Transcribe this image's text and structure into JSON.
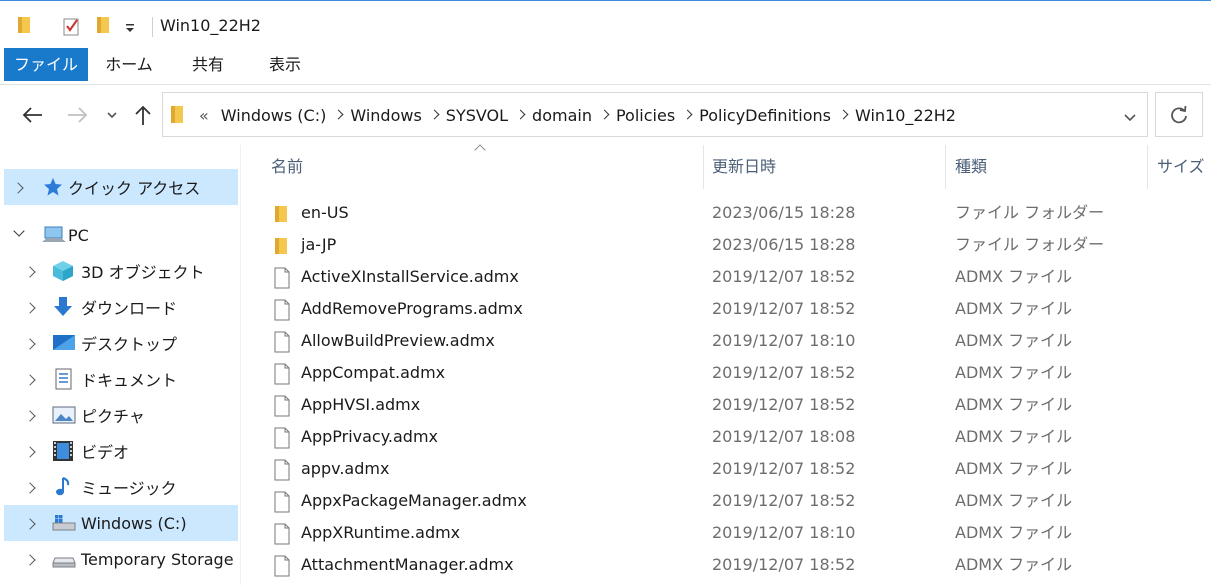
{
  "window": {
    "title": "Win10_22H2"
  },
  "ribbon": {
    "tabs": [
      "ファイル",
      "ホーム",
      "共有",
      "表示"
    ]
  },
  "address": {
    "overflow": "«",
    "crumbs": [
      "Windows (C:)",
      "Windows",
      "SYSVOL",
      "domain",
      "Policies",
      "PolicyDefinitions",
      "Win10_22H2"
    ]
  },
  "columns": {
    "name": "名前",
    "date": "更新日時",
    "type": "種類",
    "size": "サイズ"
  },
  "nav": {
    "quick_access": "クイック アクセス",
    "pc": "PC",
    "items": [
      "3D オブジェクト",
      "ダウンロード",
      "デスクトップ",
      "ドキュメント",
      "ピクチャ",
      "ビデオ",
      "ミュージック",
      "Windows (C:)",
      "Temporary Storage"
    ]
  },
  "files": [
    {
      "name": "en-US",
      "date": "2023/06/15 18:28",
      "type": "ファイル フォルダー",
      "kind": "folder"
    },
    {
      "name": "ja-JP",
      "date": "2023/06/15 18:28",
      "type": "ファイル フォルダー",
      "kind": "folder"
    },
    {
      "name": "ActiveXInstallService.admx",
      "date": "2019/12/07 18:52",
      "type": "ADMX ファイル",
      "kind": "file"
    },
    {
      "name": "AddRemovePrograms.admx",
      "date": "2019/12/07 18:52",
      "type": "ADMX ファイル",
      "kind": "file"
    },
    {
      "name": "AllowBuildPreview.admx",
      "date": "2019/12/07 18:10",
      "type": "ADMX ファイル",
      "kind": "file"
    },
    {
      "name": "AppCompat.admx",
      "date": "2019/12/07 18:52",
      "type": "ADMX ファイル",
      "kind": "file"
    },
    {
      "name": "AppHVSI.admx",
      "date": "2019/12/07 18:52",
      "type": "ADMX ファイル",
      "kind": "file"
    },
    {
      "name": "AppPrivacy.admx",
      "date": "2019/12/07 18:08",
      "type": "ADMX ファイル",
      "kind": "file"
    },
    {
      "name": "appv.admx",
      "date": "2019/12/07 18:52",
      "type": "ADMX ファイル",
      "kind": "file"
    },
    {
      "name": "AppxPackageManager.admx",
      "date": "2019/12/07 18:52",
      "type": "ADMX ファイル",
      "kind": "file"
    },
    {
      "name": "AppXRuntime.admx",
      "date": "2019/12/07 18:10",
      "type": "ADMX ファイル",
      "kind": "file"
    },
    {
      "name": "AttachmentManager.admx",
      "date": "2019/12/07 18:52",
      "type": "ADMX ファイル",
      "kind": "file"
    }
  ],
  "colors": {
    "accent": "#1979ca",
    "selection": "#cce8ff",
    "folder": "#f4c84e"
  }
}
